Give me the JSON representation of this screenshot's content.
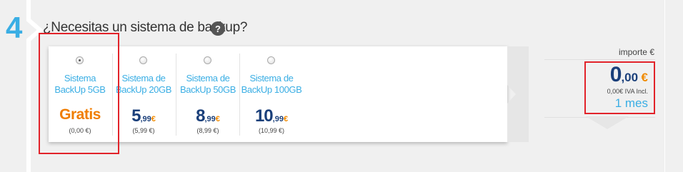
{
  "step": {
    "number": "4"
  },
  "question": {
    "text": "¿Necesitas un sistema de backup?",
    "help_icon": "question-mark-icon"
  },
  "options": [
    {
      "label_line1": "Sistema",
      "label_line2": "BackUp 5GB",
      "price_text": "Gratis",
      "small": "(0,00 €)",
      "selected": true
    },
    {
      "label_line1": "Sistema de",
      "label_line2": "BackUp 20GB",
      "price_int": "5",
      "price_dec": ",99",
      "currency": "€",
      "small": "(5,99 €)",
      "selected": false
    },
    {
      "label_line1": "Sistema de",
      "label_line2": "BackUp 50GB",
      "price_int": "8",
      "price_dec": ",99",
      "currency": "€",
      "small": "(8,99 €)",
      "selected": false
    },
    {
      "label_line1": "Sistema de",
      "label_line2": "BackUp 100GB",
      "price_int": "10",
      "price_dec": ",99",
      "currency": "€",
      "small": "(10,99 €)",
      "selected": false
    }
  ],
  "summary": {
    "importe_label": "importe €",
    "total_int": "0",
    "total_dec": ",00",
    "currency": "€",
    "iva_text": "0,00€ IVA Incl.",
    "period": "1 mes"
  },
  "colors": {
    "accent_blue": "#3aaee4",
    "dark_blue": "#1a3f7a",
    "orange": "#f07d00",
    "highlight_red": "#e2232a"
  }
}
